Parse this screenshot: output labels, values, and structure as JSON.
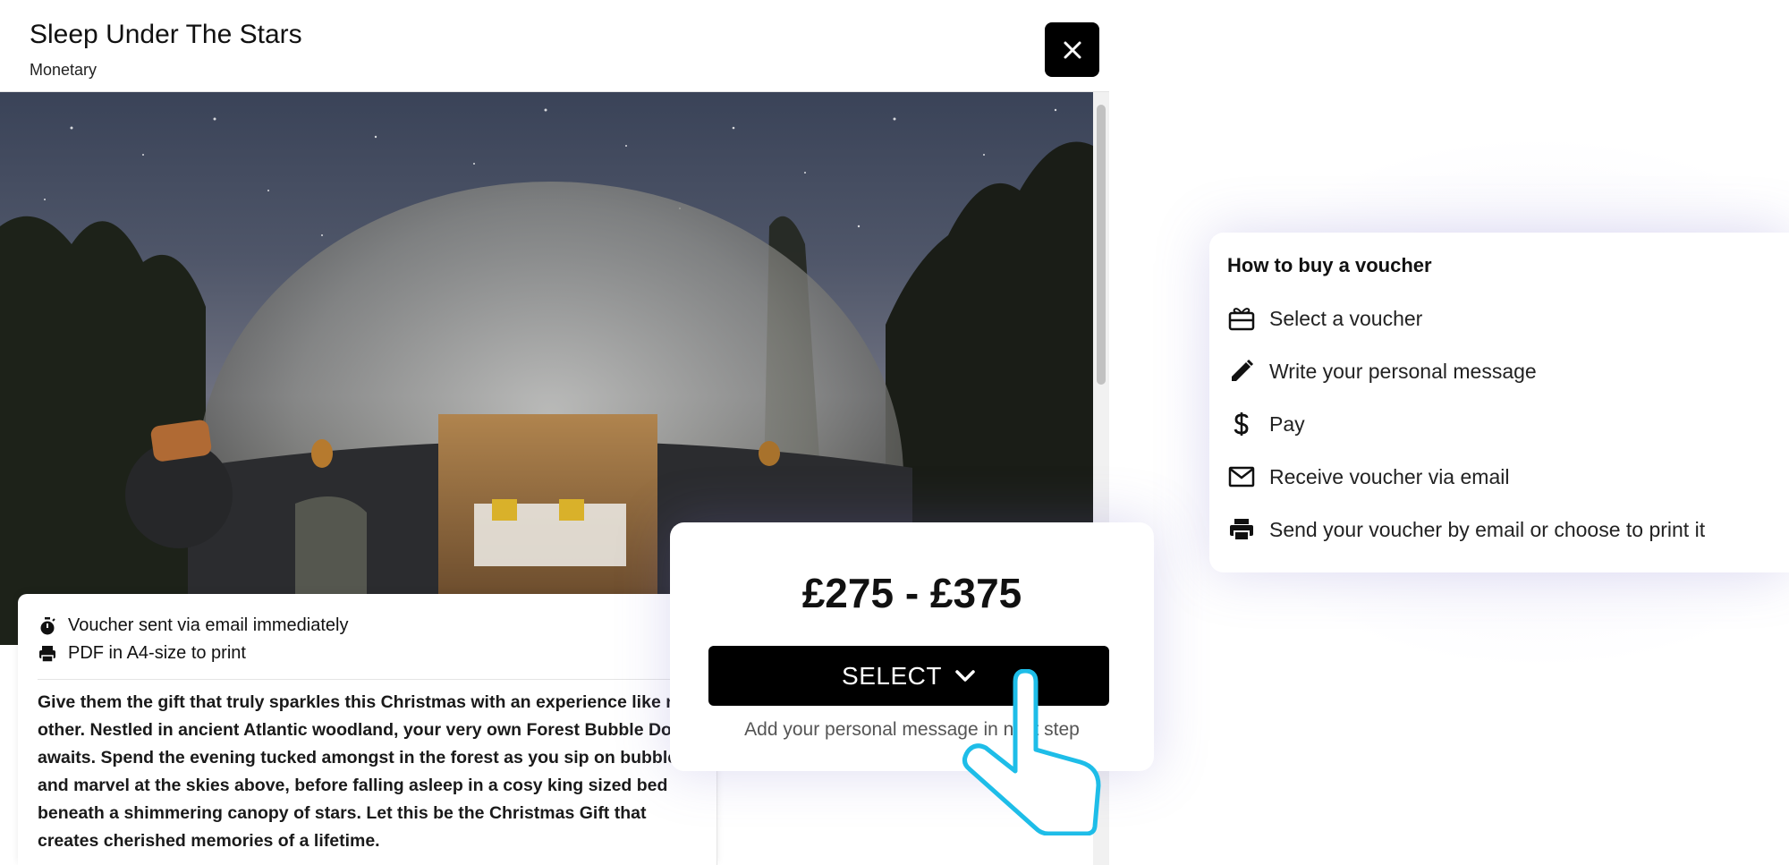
{
  "modal": {
    "title": "Sleep Under The Stars",
    "subtitle": "Monetary"
  },
  "info": {
    "delivery": "Voucher sent via email immediately",
    "format": "PDF in A4-size to print",
    "description": "Give them the gift that truly sparkles this Christmas with an experience like no other. Nestled in ancient Atlantic woodland, your very own Forest Bubble Dome awaits. Spend the evening tucked amongst in the forest as you sip on bubbles and marvel at the skies above, before falling asleep in a cosy king sized bed beneath a shimmering canopy of stars. Let this be the Christmas Gift that creates cherished memories of a lifetime."
  },
  "price_card": {
    "price": "£275 - £375",
    "select_label": "SELECT",
    "hint": "Add your personal message in next step"
  },
  "how_to": {
    "title": "How to buy a voucher",
    "steps": [
      {
        "icon": "gift-card-icon",
        "label": "Select a voucher"
      },
      {
        "icon": "pencil-icon",
        "label": "Write your personal message"
      },
      {
        "icon": "dollar-icon",
        "label": "Pay"
      },
      {
        "icon": "mail-icon",
        "label": "Receive voucher via email"
      },
      {
        "icon": "printer-icon",
        "label": "Send your voucher by email or choose to print it"
      }
    ]
  },
  "colors": {
    "button": "#000000",
    "hand_outline": "#1ebde8"
  }
}
